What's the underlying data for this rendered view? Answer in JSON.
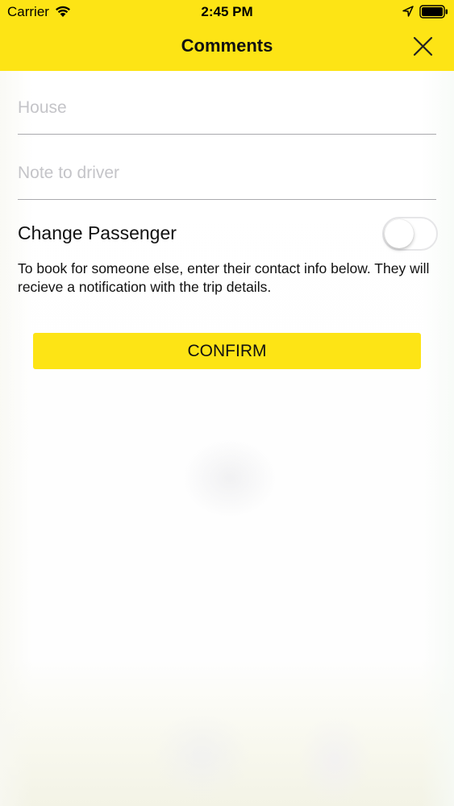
{
  "status_bar": {
    "carrier": "Carrier",
    "time": "2:45 PM"
  },
  "header": {
    "title": "Comments",
    "close_icon": "close-icon",
    "background": "#fde415"
  },
  "form": {
    "house_placeholder": "House",
    "house_value": "",
    "note_placeholder": "Note to driver",
    "note_value": "",
    "change_passenger_label": "Change Passenger",
    "change_passenger_on": false,
    "info_text": "To book for someone else, enter their contact info below. They will recieve a notification with the trip details.",
    "confirm_label": "CONFIRM"
  },
  "colors": {
    "accent": "#fde415"
  }
}
